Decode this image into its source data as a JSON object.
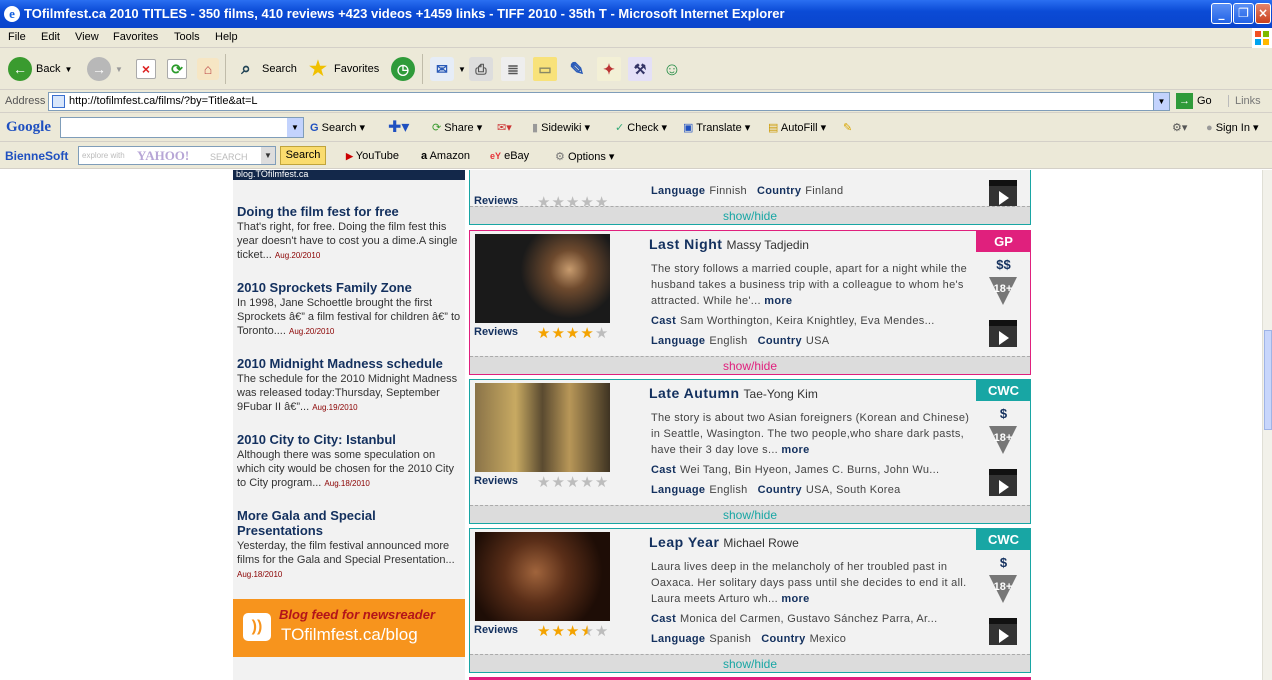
{
  "window": {
    "title": "TOfilmfest.ca 2010 TITLES - 350 films, 410 reviews +423 videos +1459 links - TIFF 2010 - 35th T - Microsoft Internet Explorer"
  },
  "menu": [
    "File",
    "Edit",
    "View",
    "Favorites",
    "Tools",
    "Help"
  ],
  "toolbar": {
    "back": "Back",
    "search": "Search",
    "favorites": "Favorites"
  },
  "address": {
    "label": "Address",
    "url": "http://tofilmfest.ca/films/?by=Title&at=L",
    "go": "Go",
    "links": "Links"
  },
  "google": {
    "logo": "Google",
    "search": "Search",
    "share": "Share",
    "sidewiki": "Sidewiki",
    "check": "Check",
    "translate": "Translate",
    "autofill": "AutoFill",
    "signin": "Sign In"
  },
  "bienne": {
    "logo": "BienneSoft",
    "placeholder_small": "explore with",
    "yahoo": "YAHOO!",
    "search_word": "SEARCH",
    "search_btn": "Search",
    "youtube": "YouTube",
    "amazon": "Amazon",
    "ebay": "eBay",
    "options": "Options"
  },
  "sidebar": {
    "logo_text": "blog.TOfilmfest.ca",
    "posts": [
      {
        "title": "Doing the film fest for free",
        "body": "That's right, for free. Doing the film fest this year doesn't have to cost you a dime.A single ticket...",
        "date": "Aug.20/2010"
      },
      {
        "title": "2010 Sprockets Family Zone",
        "body": "In 1998, Jane Schoettle brought the first Sprockets â€” a film festival for children â€” to Toronto....",
        "date": "Aug.20/2010"
      },
      {
        "title": "2010 Midnight Madness schedule",
        "body": "The schedule for the 2010 Midnight Madness was released today:Thursday, September 9Fubar II â€”...",
        "date": "Aug.19/2010"
      },
      {
        "title": "2010 City to City: Istanbul",
        "body": "Although there was some speculation on which city would be chosen for the 2010 City to City program...",
        "date": "Aug.18/2010"
      },
      {
        "title": "More Gala and Special Presentations",
        "body": "Yesterday, the film festival announced more films for the Gala and Special Presentation...",
        "date": "Aug.18/2010"
      }
    ],
    "feed": {
      "line1": "Blog feed for newsreader",
      "line2": "TOfilmfest.ca/blog"
    }
  },
  "films": [
    {
      "reviews_label": "Reviews",
      "language_label": "Language",
      "language": "Finnish",
      "country_label": "Country",
      "country": "Finland",
      "rating": 0,
      "toggle": "show/hide"
    },
    {
      "title": "Last Night",
      "director": "Massy Tadjedin",
      "synopsis": "The story follows a married couple, apart for a night while the husband takes a business trip with a colleague to whom he's attracted. While he'...",
      "more": "more",
      "cast_label": "Cast",
      "cast": "Sam Worthington, Keira Knightley, Eva Mendes...",
      "language_label": "Language",
      "language": "English",
      "country_label": "Country",
      "country": "USA",
      "badge": "GP",
      "price": "$$",
      "age": "18+",
      "reviews_label": "Reviews",
      "rating": 4,
      "toggle": "show/hide",
      "accent": "#e0207d"
    },
    {
      "title": "Late Autumn",
      "director": "Tae-Yong Kim",
      "synopsis": "The story is about two Asian foreigners (Korean and Chinese) in Seattle, Wasington. The two people,who share dark pasts, have their 3 day love s...",
      "more": "more",
      "cast_label": "Cast",
      "cast": "Wei Tang, Bin Hyeon, James C. Burns, John Wu...",
      "language_label": "Language",
      "language": "English",
      "country_label": "Country",
      "country": "USA, South Korea",
      "badge": "CWC",
      "price": "$",
      "age": "18+",
      "reviews_label": "Reviews",
      "rating": 0,
      "toggle": "show/hide",
      "accent": "#18a6a4"
    },
    {
      "title": "Leap Year",
      "director": "Michael Rowe",
      "synopsis": "Laura lives deep in the melancholy of her troubled past in Oaxaca. Her solitary days pass until she decides to end it all. Laura meets Arturo wh...",
      "more": "more",
      "cast_label": "Cast",
      "cast": "Monica del Carmen, Gustavo Sánchez Parra, Ar...",
      "language_label": "Language",
      "language": "Spanish",
      "country_label": "Country",
      "country": "Mexico",
      "badge": "CWC",
      "price": "$",
      "age": "18+",
      "reviews_label": "Reviews",
      "rating": 3.5,
      "toggle": "show/hide",
      "accent": "#18a6a4"
    }
  ]
}
